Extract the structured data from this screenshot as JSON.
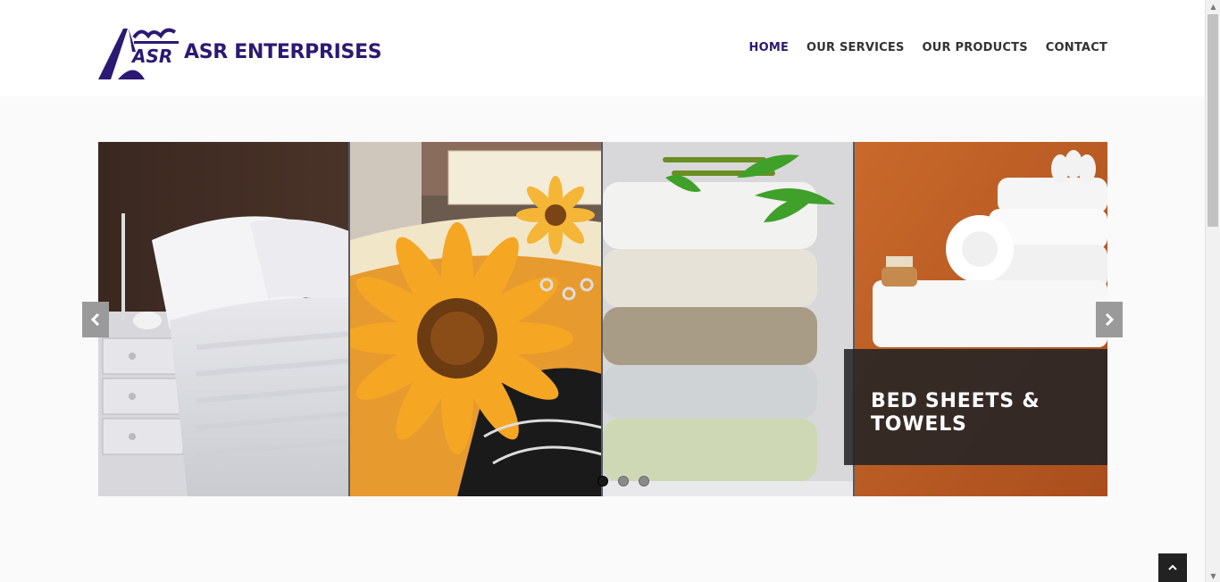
{
  "brand": {
    "name": "ASR ENTERPRISES",
    "color": "#2b1a73"
  },
  "nav": {
    "items": [
      {
        "label": "HOME",
        "active": true
      },
      {
        "label": "OUR SERVICES",
        "active": false
      },
      {
        "label": "OUR PRODUCTS",
        "active": false
      },
      {
        "label": "CONTACT",
        "active": false
      }
    ]
  },
  "slider": {
    "caption": "BED SHEETS & TOWELS",
    "slide_count": 3,
    "active_slide": 1,
    "prev_icon": "chevron-left-icon",
    "next_icon": "chevron-right-icon"
  },
  "back_to_top": {
    "icon": "chevron-up-icon"
  }
}
